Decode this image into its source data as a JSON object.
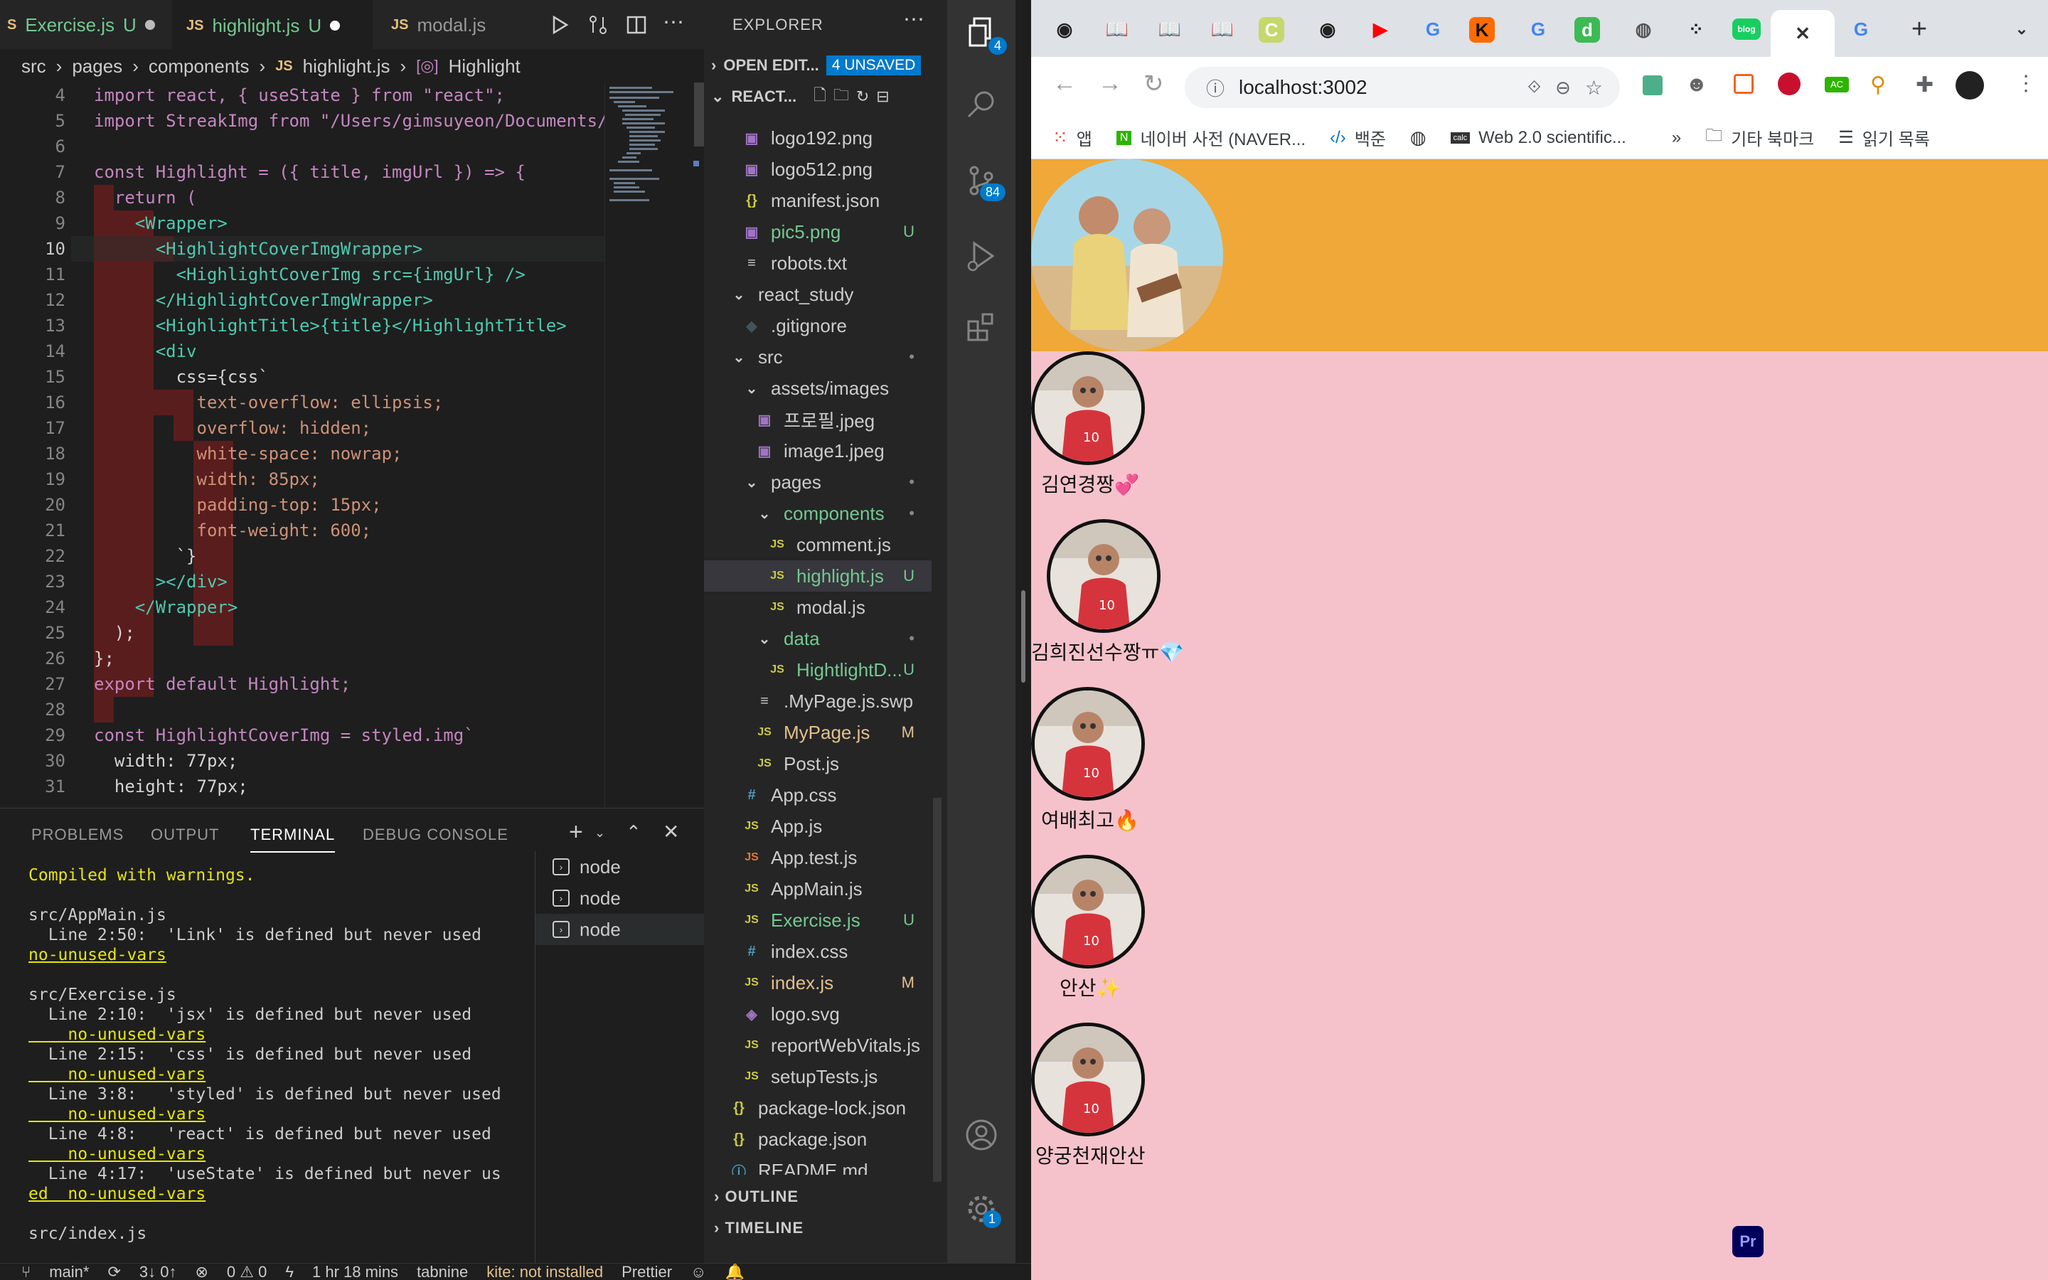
{
  "editor": {
    "tabs": [
      {
        "label": "Exercise.js",
        "badge": "U",
        "modified": true,
        "active": false
      },
      {
        "label": "highlight.js",
        "badge": "U",
        "modified": true,
        "active": true
      },
      {
        "label": "modal.js",
        "badge": "",
        "modified": false,
        "active": false
      }
    ],
    "breadcrumb": [
      "src",
      "pages",
      "components",
      "highlight.js",
      "Highlight"
    ],
    "lines": [
      {
        "n": "4",
        "t": "import react, { useState } from \"react\";"
      },
      {
        "n": "5",
        "t": "import StreakImg from \"/Users/gimsuyeon/Documents/"
      },
      {
        "n": "6",
        "t": ""
      },
      {
        "n": "7",
        "t": "const Highlight = ({ title, imgUrl }) => {"
      },
      {
        "n": "8",
        "t": "  return ("
      },
      {
        "n": "9",
        "t": "    <Wrapper>"
      },
      {
        "n": "10",
        "t": "      <HighlightCoverImgWrapper>"
      },
      {
        "n": "11",
        "t": "        <HighlightCoverImg src={imgUrl} />"
      },
      {
        "n": "12",
        "t": "      </HighlightCoverImgWrapper>"
      },
      {
        "n": "13",
        "t": "      <HighlightTitle>{title}</HighlightTitle>"
      },
      {
        "n": "14",
        "t": "      <div"
      },
      {
        "n": "15",
        "t": "        css={css`"
      },
      {
        "n": "16",
        "t": "          text-overflow: ellipsis;"
      },
      {
        "n": "17",
        "t": "          overflow: hidden;"
      },
      {
        "n": "18",
        "t": "          white-space: nowrap;"
      },
      {
        "n": "19",
        "t": "          width: 85px;"
      },
      {
        "n": "20",
        "t": "          padding-top: 15px;"
      },
      {
        "n": "21",
        "t": "          font-weight: 600;"
      },
      {
        "n": "22",
        "t": "        `}"
      },
      {
        "n": "23",
        "t": "      ></div>"
      },
      {
        "n": "24",
        "t": "    </Wrapper>"
      },
      {
        "n": "25",
        "t": "  );"
      },
      {
        "n": "26",
        "t": "};"
      },
      {
        "n": "27",
        "t": "export default Highlight;"
      },
      {
        "n": "28",
        "t": ""
      },
      {
        "n": "29",
        "t": "const HighlightCoverImg = styled.img`"
      },
      {
        "n": "30",
        "t": "  width: 77px;"
      },
      {
        "n": "31",
        "t": "  height: 77px;"
      }
    ]
  },
  "panel": {
    "tabs": [
      "PROBLEMS",
      "OUTPUT",
      "TERMINAL",
      "DEBUG CONSOLE"
    ],
    "active_tab": "TERMINAL",
    "terminal": [
      {
        "t": "Compiled with warnings.",
        "c": "warn"
      },
      {
        "t": "",
        "c": ""
      },
      {
        "t": "src/AppMain.js",
        "c": ""
      },
      {
        "t": "  Line 2:50:  'Link' is defined but never used",
        "c": ""
      },
      {
        "t": "no-unused-vars",
        "c": "uline"
      },
      {
        "t": "",
        "c": ""
      },
      {
        "t": "src/Exercise.js",
        "c": ""
      },
      {
        "t": "  Line 2:10:  'jsx' is defined but never used",
        "c": ""
      },
      {
        "t": "    no-unused-vars",
        "c": "uline"
      },
      {
        "t": "  Line 2:15:  'css' is defined but never used",
        "c": ""
      },
      {
        "t": "    no-unused-vars",
        "c": "uline"
      },
      {
        "t": "  Line 3:8:   'styled' is defined but never used",
        "c": ""
      },
      {
        "t": "    no-unused-vars",
        "c": "uline"
      },
      {
        "t": "  Line 4:8:   'react' is defined but never used",
        "c": ""
      },
      {
        "t": "    no-unused-vars",
        "c": "uline"
      },
      {
        "t": "  Line 4:17:  'useState' is defined but never us",
        "c": ""
      },
      {
        "t": "ed  no-unused-vars",
        "c": "uline"
      },
      {
        "t": "",
        "c": ""
      },
      {
        "t": "src/index.js",
        "c": ""
      }
    ],
    "terminals": [
      "node",
      "node",
      "node"
    ]
  },
  "explorer": {
    "title": "EXPLORER",
    "open_editors": "OPEN EDIT...",
    "unsaved": "4 UNSAVED",
    "project": "REACT...",
    "items": [
      {
        "label": "logo192.png",
        "icon": "img",
        "depth": 2,
        "status": "",
        "color": "#ccc"
      },
      {
        "label": "logo512.png",
        "icon": "img",
        "depth": 2,
        "status": "",
        "color": "#ccc"
      },
      {
        "label": "manifest.json",
        "icon": "json",
        "depth": 2,
        "status": "",
        "color": "#ccc"
      },
      {
        "label": "pic5.png",
        "icon": "img",
        "depth": 2,
        "status": "U",
        "color": "#73c991"
      },
      {
        "label": "robots.txt",
        "icon": "txt",
        "depth": 2,
        "status": "",
        "color": "#ccc"
      },
      {
        "label": "react_study",
        "icon": "folder",
        "depth": 1,
        "status": "",
        "color": "#ccc"
      },
      {
        "label": ".gitignore",
        "icon": "git",
        "depth": 2,
        "status": "",
        "color": "#ccc"
      },
      {
        "label": "src",
        "icon": "folder",
        "depth": 1,
        "status": "•",
        "color": "#ccc"
      },
      {
        "label": "assets/images",
        "icon": "folder",
        "depth": 2,
        "status": "",
        "color": "#ccc"
      },
      {
        "label": "프로필.jpeg",
        "icon": "img",
        "depth": 3,
        "status": "",
        "color": "#ccc"
      },
      {
        "label": "image1.jpeg",
        "icon": "img",
        "depth": 3,
        "status": "",
        "color": "#ccc"
      },
      {
        "label": "pages",
        "icon": "folder",
        "depth": 2,
        "status": "•",
        "color": "#ccc"
      },
      {
        "label": "components",
        "icon": "folder",
        "depth": 3,
        "status": "•",
        "color": "#73c991"
      },
      {
        "label": "comment.js",
        "icon": "js",
        "depth": 4,
        "status": "",
        "color": "#ccc"
      },
      {
        "label": "highlight.js",
        "icon": "js",
        "depth": 4,
        "status": "U",
        "color": "#73c991"
      },
      {
        "label": "modal.js",
        "icon": "js",
        "depth": 4,
        "status": "",
        "color": "#ccc"
      },
      {
        "label": "data",
        "icon": "folder",
        "depth": 3,
        "status": "•",
        "color": "#73c991"
      },
      {
        "label": "HightlightD...",
        "icon": "js",
        "depth": 4,
        "status": "U",
        "color": "#73c991"
      },
      {
        "label": ".MyPage.js.swp",
        "icon": "txt",
        "depth": 3,
        "status": "",
        "color": "#ccc"
      },
      {
        "label": "MyPage.js",
        "icon": "js",
        "depth": 3,
        "status": "M",
        "color": "#e2c08d"
      },
      {
        "label": "Post.js",
        "icon": "js",
        "depth": 3,
        "status": "",
        "color": "#ccc"
      },
      {
        "label": "App.css",
        "icon": "css",
        "depth": 2,
        "status": "",
        "color": "#ccc"
      },
      {
        "label": "App.js",
        "icon": "js",
        "depth": 2,
        "status": "",
        "color": "#ccc"
      },
      {
        "label": "App.test.js",
        "icon": "test",
        "depth": 2,
        "status": "",
        "color": "#ccc"
      },
      {
        "label": "AppMain.js",
        "icon": "js",
        "depth": 2,
        "status": "",
        "color": "#ccc"
      },
      {
        "label": "Exercise.js",
        "icon": "js",
        "depth": 2,
        "status": "U",
        "color": "#73c991"
      },
      {
        "label": "index.css",
        "icon": "css",
        "depth": 2,
        "status": "",
        "color": "#ccc"
      },
      {
        "label": "index.js",
        "icon": "js",
        "depth": 2,
        "status": "M",
        "color": "#e2c08d"
      },
      {
        "label": "logo.svg",
        "icon": "svg",
        "depth": 2,
        "status": "",
        "color": "#ccc"
      },
      {
        "label": "reportWebVitals.js",
        "icon": "js",
        "depth": 2,
        "status": "",
        "color": "#ccc"
      },
      {
        "label": "setupTests.js",
        "icon": "js",
        "depth": 2,
        "status": "",
        "color": "#ccc"
      },
      {
        "label": "package-lock.json",
        "icon": "json",
        "depth": 1,
        "status": "",
        "color": "#ccc"
      },
      {
        "label": "package.json",
        "icon": "json",
        "depth": 1,
        "status": "",
        "color": "#ccc"
      },
      {
        "label": "README.md",
        "icon": "info",
        "depth": 1,
        "status": "",
        "color": "#ccc"
      }
    ],
    "outline": "OUTLINE",
    "timeline": "TIMELINE"
  },
  "activity": {
    "explorer_badge": "4",
    "scm_badge": "84",
    "settings_badge": "1"
  },
  "status": {
    "branch": "main*",
    "sync": "3↓ 0↑",
    "problems": "0 ⚠ 0",
    "time": "1 hr 18 mins",
    "tabnine": "tabnine",
    "kite": "kite: not installed",
    "prettier": "Prettier"
  },
  "browser": {
    "url": "localhost:3002",
    "bookmarks": [
      "앱",
      "네이버 사전 (NAVER...",
      "백준",
      "Web 2.0 scientific...",
      "기타 북마크",
      "읽기 목록"
    ],
    "highlights": [
      {
        "title": "김연경짱💞"
      },
      {
        "title": "김희진선수짱ㅠ💎"
      },
      {
        "title": "여배최고🔥"
      },
      {
        "title": "안산✨"
      },
      {
        "title": "양궁천재안산"
      }
    ],
    "colors": {
      "hero": "#f0a838",
      "list": "#f5c2cb"
    },
    "dock_app": "Pr"
  }
}
